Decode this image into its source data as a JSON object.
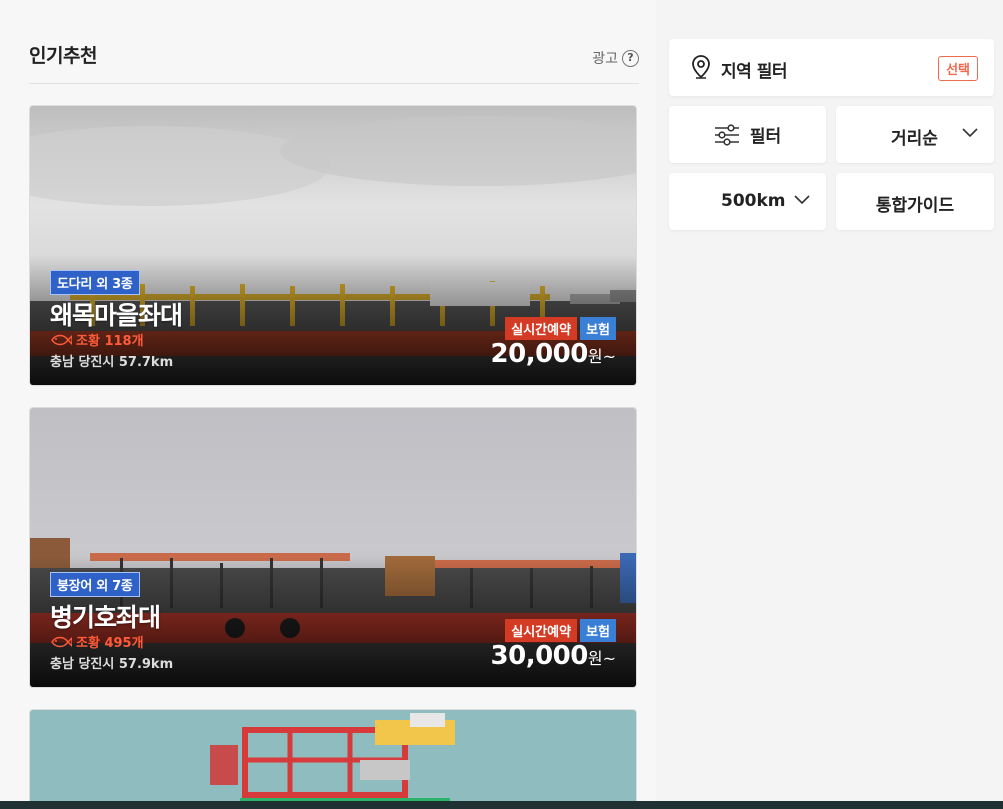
{
  "section": {
    "title": "인기추천",
    "ad_label": "광고",
    "help_glyph": "?"
  },
  "cards": [
    {
      "fish_tag": "도다리 외 3종",
      "name": "왜목마을좌대",
      "catch": "조황 118개",
      "location": "충남 당진시 57.7km",
      "badge_live": "실시간예약",
      "badge_insurance": "보험",
      "price": "20,000",
      "price_unit": "원~"
    },
    {
      "fish_tag": "붕장어 외 7종",
      "name": "병기호좌대",
      "catch": "조황 495개",
      "location": "충남 당진시 57.9km",
      "badge_live": "실시간예약",
      "badge_insurance": "보험",
      "price": "30,000",
      "price_unit": "원~"
    }
  ],
  "sidebar": {
    "region_filter_label": "지역 필터",
    "region_select_label": "선택",
    "filter_label": "필터",
    "sort_label": "거리순",
    "distance_label": "500km",
    "guide_label": "통합가이드"
  },
  "colors": {
    "accent_red": "#d43b24",
    "accent_blue": "#3a7fd6",
    "tag_blue": "#2e62c9",
    "catch_orange": "#ff5b3a",
    "select_orange": "#f06a4f"
  },
  "icons": {
    "help": "help-circle-icon",
    "pin": "location-pin-icon",
    "filter": "sliders-icon",
    "chevron": "chevron-down-icon",
    "fish": "fish-icon"
  }
}
